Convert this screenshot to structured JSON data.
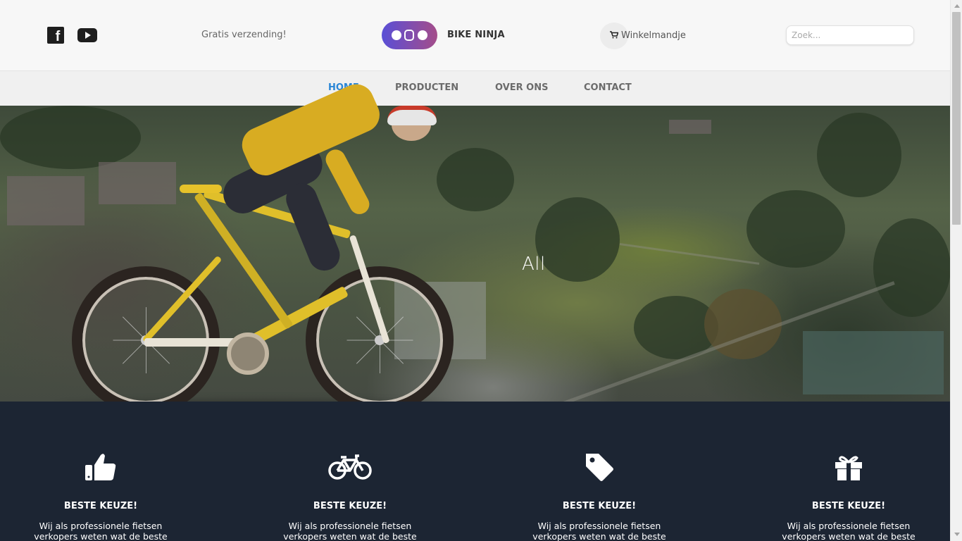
{
  "header": {
    "shipping_text": "Gratis verzending!",
    "brand_name": "BIKE NINJA",
    "cart_label": "Winkelmandje",
    "search_placeholder": "Zoek...",
    "social": [
      "facebook-icon",
      "youtube-icon"
    ],
    "cart_icon": "shopping-cart-icon"
  },
  "nav": {
    "items": [
      {
        "label": "HOME",
        "active": true
      },
      {
        "label": "PRODUCTEN",
        "active": false
      },
      {
        "label": "OVER ONS",
        "active": false
      },
      {
        "label": "CONTACT",
        "active": false
      }
    ]
  },
  "hero": {
    "text": "All"
  },
  "features": [
    {
      "icon": "thumbs-up-icon",
      "title": "BESTE KEUZE!",
      "text": "Wij als professionele fietsen verkopers weten wat de beste"
    },
    {
      "icon": "bicycle-icon",
      "title": "BESTE KEUZE!",
      "text": "Wij als professionele fietsen verkopers weten wat de beste"
    },
    {
      "icon": "tag-icon",
      "title": "BESTE KEUZE!",
      "text": "Wij als professionele fietsen verkopers weten wat de beste"
    },
    {
      "icon": "gift-icon",
      "title": "BESTE KEUZE!",
      "text": "Wij als professionele fietsen verkopers weten wat de beste"
    }
  ],
  "colors": {
    "nav_active": "#2a86d6",
    "nav_default": "#6b6b6b",
    "features_bg": "#1c2533",
    "logo_gradient_start": "#5a4fd6",
    "logo_gradient_end": "#a44d8a"
  }
}
